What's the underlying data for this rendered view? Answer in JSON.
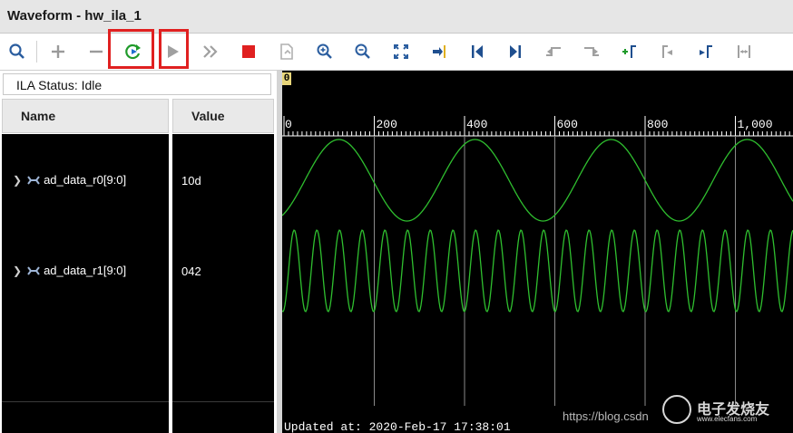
{
  "window": {
    "title": "Waveform - hw_ila_1"
  },
  "toolbar": {
    "buttons": [
      {
        "name": "search-icon"
      },
      {
        "name": "add-icon"
      },
      {
        "name": "remove-icon"
      },
      {
        "name": "run-trigger-immediate-icon"
      },
      {
        "name": "run-trigger-icon"
      },
      {
        "name": "fast-forward-icon"
      },
      {
        "name": "stop-icon"
      },
      {
        "name": "export-icon"
      },
      {
        "name": "zoom-in-icon"
      },
      {
        "name": "zoom-out-icon"
      },
      {
        "name": "zoom-fit-icon"
      },
      {
        "name": "goto-cursor-icon"
      },
      {
        "name": "go-to-start-icon"
      },
      {
        "name": "go-to-end-icon"
      },
      {
        "name": "previous-transition-icon"
      },
      {
        "name": "next-transition-icon"
      },
      {
        "name": "add-marker-icon"
      },
      {
        "name": "previous-marker-icon"
      },
      {
        "name": "next-marker-icon"
      },
      {
        "name": "swap-cursors-icon"
      }
    ]
  },
  "ila_status": {
    "label": "ILA Status:",
    "value": "Idle"
  },
  "columns": {
    "name": "Name",
    "value": "Value"
  },
  "signals": [
    {
      "name": "ad_data_r0[9:0]",
      "value": "10d"
    },
    {
      "name": "ad_data_r1[9:0]",
      "value": "042"
    }
  ],
  "waveform": {
    "cursor_label": "0",
    "ruler_ticks": [
      "0",
      "200",
      "400",
      "600",
      "800",
      "1,000"
    ],
    "updated_text": "Updated at: 2020-Feb-17 17:38:01",
    "signal_color": "#2fbf2f"
  },
  "watermark": {
    "url": "https://blog.csdn",
    "brand_cn": "电子发烧友",
    "brand_en": "www.elecfans.com"
  },
  "colors": {
    "highlight_box": "#e02020",
    "stop": "#e02020",
    "run_green": "#1f9a2a"
  }
}
